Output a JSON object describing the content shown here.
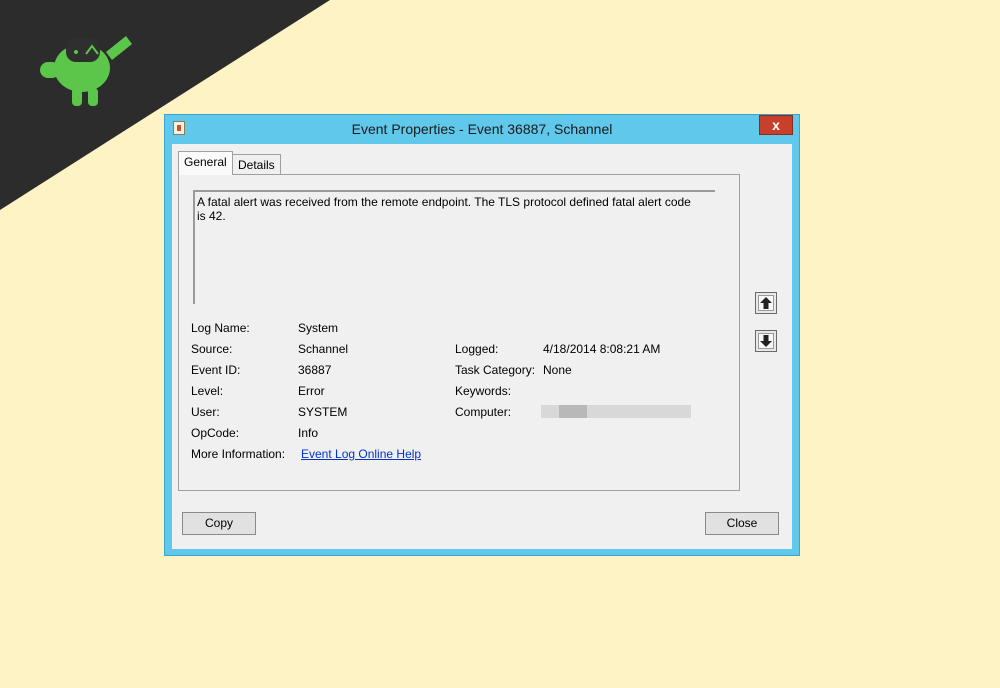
{
  "window": {
    "title": "Event Properties - Event 36887, Schannel",
    "close_glyph": "x"
  },
  "tabs": [
    {
      "label": "General",
      "selected": true
    },
    {
      "label": "Details",
      "selected": false
    }
  ],
  "message": "A fatal alert was received from the remote endpoint. The TLS protocol defined fatal alert code is 42.",
  "fields": {
    "log_name": {
      "label": "Log Name:",
      "value": "System"
    },
    "source": {
      "label": "Source:",
      "value": "Schannel"
    },
    "logged": {
      "label": "Logged:",
      "value": "4/18/2014 8:08:21 AM"
    },
    "event_id": {
      "label": "Event ID:",
      "value": "36887"
    },
    "task_category": {
      "label": "Task Category:",
      "value": "None"
    },
    "level": {
      "label": "Level:",
      "value": "Error"
    },
    "keywords": {
      "label": "Keywords:",
      "value": ""
    },
    "user": {
      "label": "User:",
      "value": "SYSTEM"
    },
    "computer": {
      "label": "Computer:",
      "value": ""
    },
    "opcode": {
      "label": "OpCode:",
      "value": "Info"
    },
    "more_information": {
      "label": "More Information:",
      "link_text": "Event Log Online Help"
    }
  },
  "buttons": {
    "copy": "Copy",
    "close": "Close"
  },
  "icons": {
    "logo": "android-robot-logo",
    "window_icon": "event-viewer-icon",
    "up": "arrow-up-icon",
    "down": "arrow-down-icon"
  },
  "colors": {
    "background": "#fdf3c4",
    "corner": "#2c2c2c",
    "logo_green": "#5cc64a",
    "window_frame": "#60c8ea",
    "close_red": "#c7402c",
    "link": "#0033cc"
  }
}
